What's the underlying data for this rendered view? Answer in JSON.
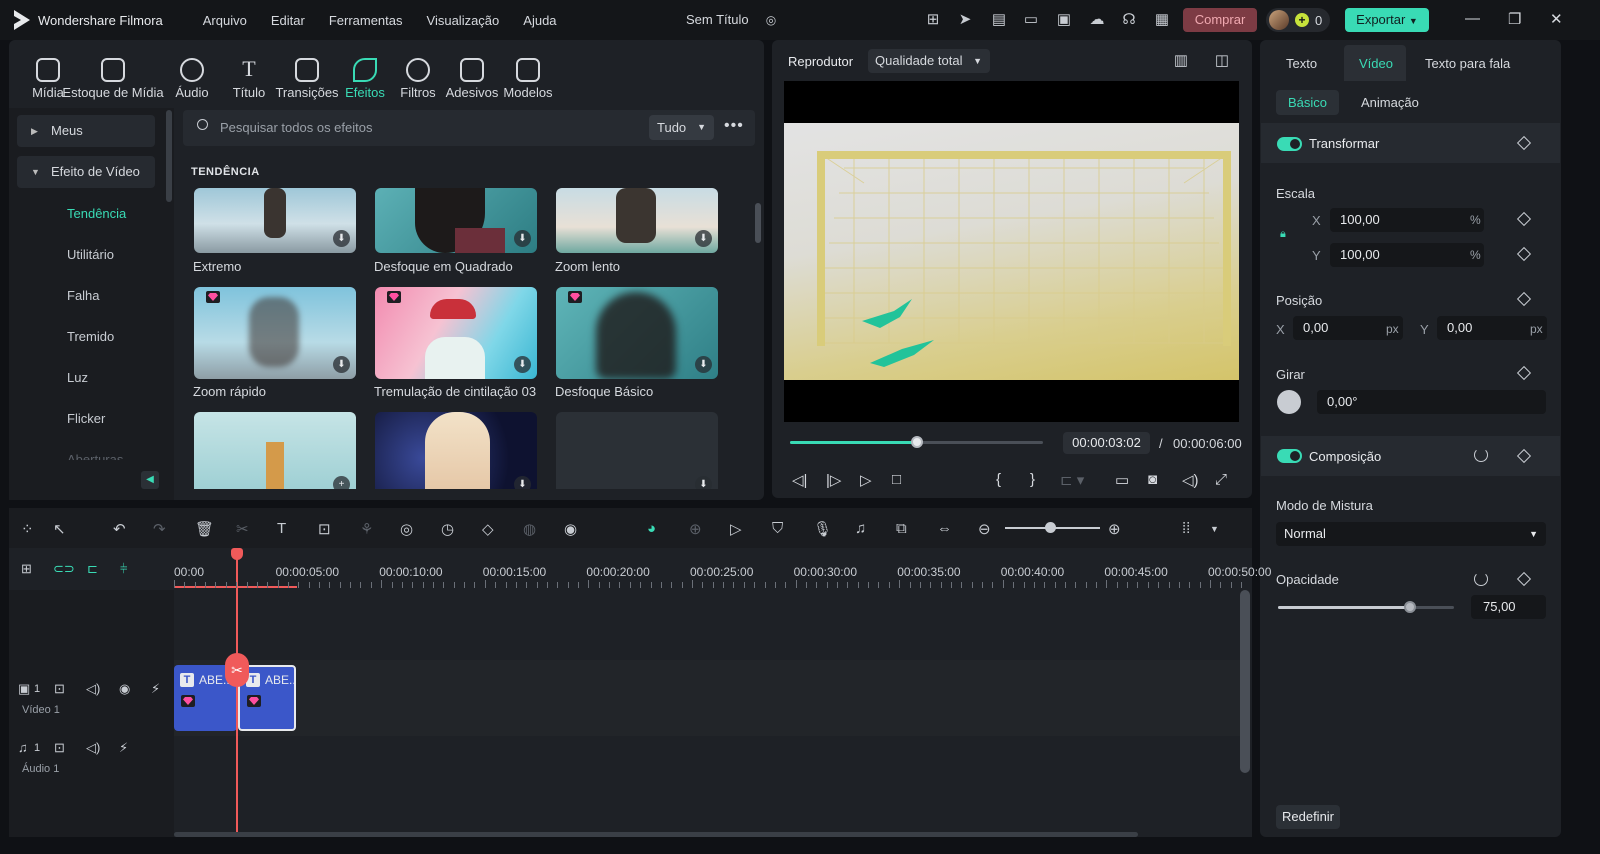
{
  "app": {
    "name": "Wondershare Filmora",
    "document_title": "Sem Título"
  },
  "menu": [
    "Arquivo",
    "Editar",
    "Ferramentas",
    "Visualização",
    "Ajuda"
  ],
  "topbar": {
    "buy_label": "Comprar",
    "credits": "0",
    "export_label": "Exportar"
  },
  "library_tabs": [
    {
      "label": "Mídia",
      "icon": "media-icon"
    },
    {
      "label": "Estoque de Mídia",
      "icon": "stock-media-icon"
    },
    {
      "label": "Áudio",
      "icon": "music-note-icon"
    },
    {
      "label": "Título",
      "icon": "title-t-icon"
    },
    {
      "label": "Transições",
      "icon": "transition-icon"
    },
    {
      "label": "Efeitos",
      "icon": "effects-star-icon",
      "active": true
    },
    {
      "label": "Filtros",
      "icon": "filter-icon"
    },
    {
      "label": "Adesivos",
      "icon": "sticker-icon"
    },
    {
      "label": "Modelos",
      "icon": "template-icon"
    }
  ],
  "sidebar": {
    "groups": [
      {
        "label": "Meus",
        "expanded": false
      },
      {
        "label": "Efeito de Vídeo",
        "expanded": true
      }
    ],
    "items": [
      "Tendência",
      "Utilitário",
      "Falha",
      "Tremido",
      "Luz",
      "Flicker",
      "Aberturas"
    ],
    "active_item": "Tendência"
  },
  "search": {
    "placeholder": "Pesquisar todos os efeitos",
    "filter": "Tudo"
  },
  "effects": {
    "section_title": "TENDÊNCIA",
    "items": [
      {
        "caption": "Extremo",
        "premium": false
      },
      {
        "caption": "Desfoque em Quadrado",
        "premium": false
      },
      {
        "caption": "Zoom lento",
        "premium": false
      },
      {
        "caption": "Zoom rápido",
        "premium": true
      },
      {
        "caption": "Tremulação de cintilação 03",
        "premium": true
      },
      {
        "caption": "Desfoque Básico",
        "premium": true
      }
    ]
  },
  "player": {
    "title": "Reprodutor",
    "quality": "Qualidade total",
    "current_time": "00:00:03:02",
    "separator": "/",
    "duration": "00:00:06:00",
    "progress": 0.5
  },
  "properties": {
    "tabs": [
      "Texto",
      "Vídeo",
      "Texto para fala"
    ],
    "active_tab": "Vídeo",
    "subtabs": [
      "Básico",
      "Animação"
    ],
    "transform": {
      "title": "Transformar",
      "enabled": true,
      "scale_label": "Escala",
      "scale_x": "100,00",
      "scale_y": "100,00",
      "scale_unit": "%",
      "position_label": "Posição",
      "pos_x": "0,00",
      "pos_y": "0,00",
      "pos_unit": "px",
      "rotate_label": "Girar",
      "rotate": "0,00°",
      "x_label": "X",
      "y_label": "Y"
    },
    "composition": {
      "title": "Composição",
      "enabled": true,
      "blend_label": "Modo de Mistura",
      "blend_value": "Normal",
      "opacity_label": "Opacidade",
      "opacity_value": "75,00",
      "opacity": 0.75
    },
    "reset_label": "Redefinir"
  },
  "timeline": {
    "ruler": [
      "00:00",
      "00:00:05:00",
      "00:00:10:00",
      "00:00:15:00",
      "00:00:20:00",
      "00:00:25:00",
      "00:00:30:00",
      "00:00:35:00",
      "00:00:40:00",
      "00:00:45:00",
      "00:00:50:00"
    ],
    "tracks": [
      {
        "name": "Vídeo 1",
        "index": "1"
      },
      {
        "name": "Áudio 1",
        "index": "1"
      }
    ],
    "clips": [
      {
        "label": "ABE..."
      },
      {
        "label": "ABE..."
      }
    ]
  },
  "colors": {
    "accent": "#39dbb5",
    "playhead": "#f05a5a",
    "clip": "#3b57c9",
    "premium": "#ff4fa0"
  }
}
